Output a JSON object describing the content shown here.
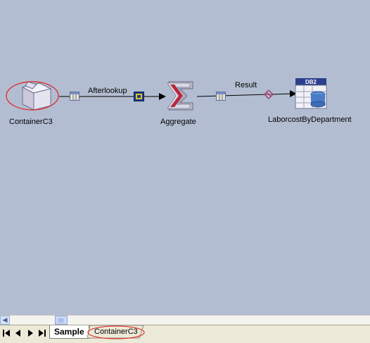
{
  "canvas": {
    "background": "#b3bdd2",
    "nodes": [
      {
        "id": "containerc3",
        "label": "ContainerC3",
        "icon": "container-box-icon",
        "highlighted": true
      },
      {
        "id": "aggregate",
        "label": "Aggregate",
        "icon": "sigma-aggregate-icon"
      },
      {
        "id": "laborcost",
        "label": "LaborcostByDepartment",
        "icon": "db2-table-icon",
        "badge": "DB2"
      }
    ],
    "links": [
      {
        "label": "Afterlookup"
      },
      {
        "label": "Result"
      }
    ],
    "highlight_color": "#e0201c"
  },
  "tabs": {
    "items": [
      {
        "label": "Sample",
        "active": true
      },
      {
        "label": "ContainerC3",
        "active": false,
        "highlighted": true
      }
    ]
  },
  "navigation": {
    "icons": [
      "first-icon",
      "previous-icon",
      "next-icon",
      "last-icon"
    ]
  }
}
